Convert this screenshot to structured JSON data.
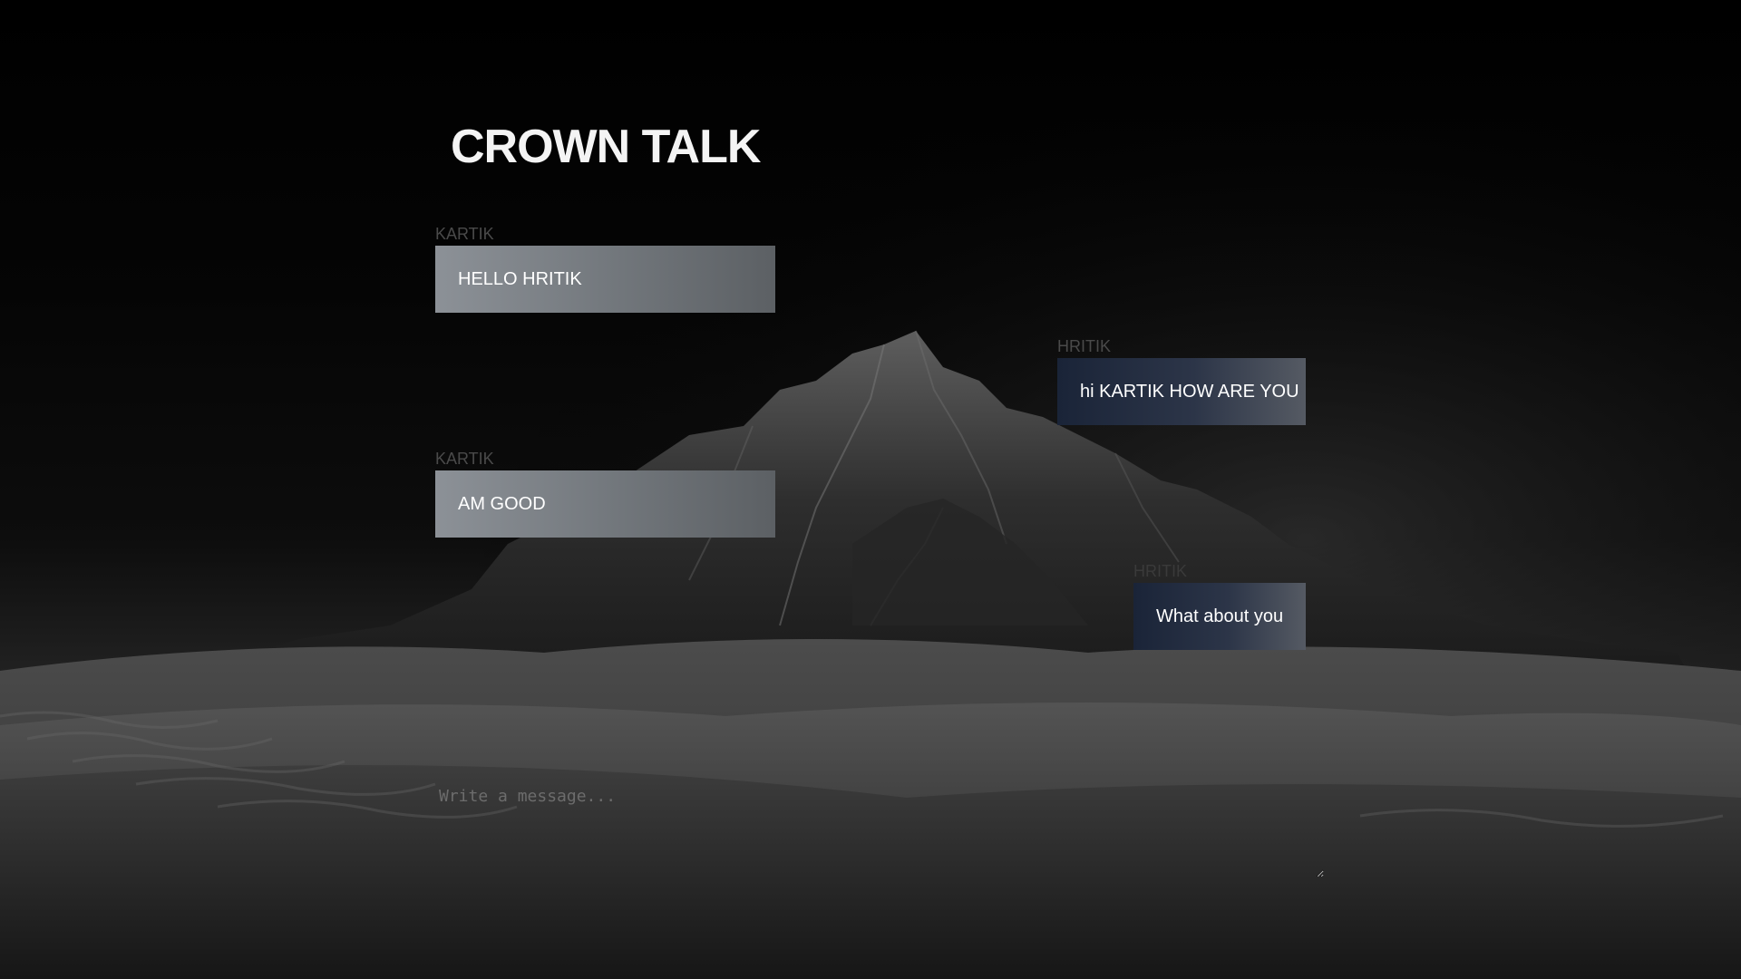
{
  "app": {
    "title": "CROWN TALK"
  },
  "messages": [
    {
      "sender": "KARTIK",
      "text": "HELLO HRITIK",
      "side": "left"
    },
    {
      "sender": "HRITIK",
      "text": "hi KARTIK HOW ARE YOU",
      "side": "right"
    },
    {
      "sender": "KARTIK",
      "text": "AM GOOD",
      "side": "left"
    },
    {
      "sender": "HRITIK",
      "text": "What about you",
      "side": "right"
    }
  ],
  "composer": {
    "placeholder": "Write a message...",
    "value": ""
  },
  "colors": {
    "title": "#f4f4f4",
    "sender_label": "#4a4a4a",
    "left_bubble": "#8c9197",
    "right_bubble": "#1a2438",
    "background": "#050505"
  },
  "background": {
    "icon": "desert-mountain-night-image"
  }
}
